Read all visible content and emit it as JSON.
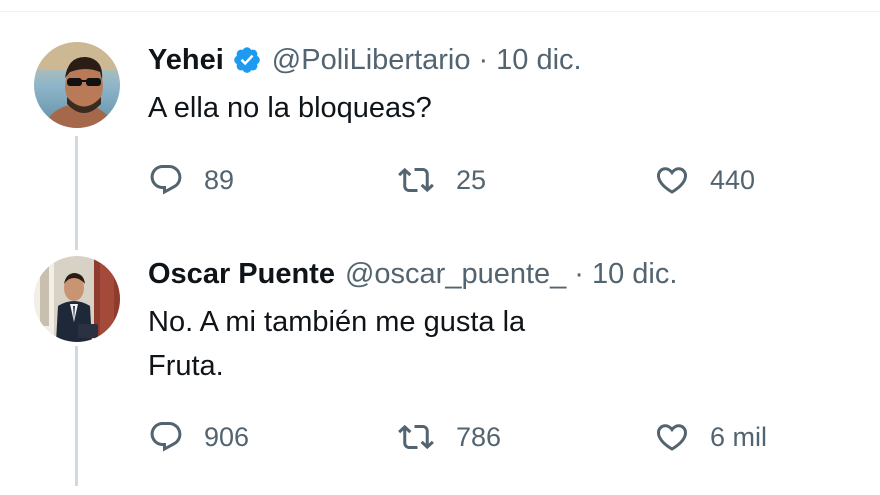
{
  "colors": {
    "text_primary": "#0f1419",
    "text_secondary": "#536471",
    "verified_blue": "#1d9bf0",
    "thread_line": "#cfd9de"
  },
  "tweets": [
    {
      "name": "Yehei",
      "verified": true,
      "handle": "@PoliLibertario",
      "separator": "·",
      "date": "10 dic.",
      "text_lines": [
        "A ella no la bloqueas?"
      ],
      "replies": "89",
      "retweets": "25",
      "likes": "440",
      "avatar_icon": "avatar-photo"
    },
    {
      "name": "Oscar Puente",
      "verified": false,
      "handle": "@oscar_puente_",
      "separator": "·",
      "date": "10 dic.",
      "text_lines": [
        "No. A mi también me gusta la",
        "Fruta."
      ],
      "replies": "906",
      "retweets": "786",
      "likes": "6 mil",
      "avatar_icon": "avatar-photo"
    }
  ],
  "icons": {
    "reply": "reply-icon",
    "retweet": "retweet-icon",
    "like": "heart-icon",
    "verified": "verified-badge-icon"
  }
}
